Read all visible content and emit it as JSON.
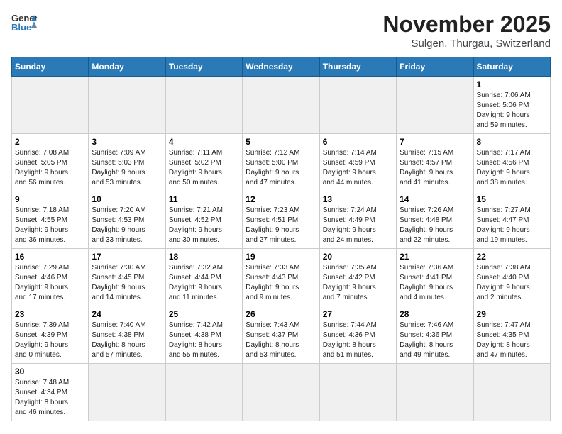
{
  "header": {
    "logo_text_general": "General",
    "logo_text_blue": "Blue",
    "month_title": "November 2025",
    "subtitle": "Sulgen, Thurgau, Switzerland"
  },
  "weekdays": [
    "Sunday",
    "Monday",
    "Tuesday",
    "Wednesday",
    "Thursday",
    "Friday",
    "Saturday"
  ],
  "weeks": [
    {
      "days": [
        {
          "num": "",
          "info": "",
          "empty": true
        },
        {
          "num": "",
          "info": "",
          "empty": true
        },
        {
          "num": "",
          "info": "",
          "empty": true
        },
        {
          "num": "",
          "info": "",
          "empty": true
        },
        {
          "num": "",
          "info": "",
          "empty": true
        },
        {
          "num": "",
          "info": "",
          "empty": true
        },
        {
          "num": "1",
          "info": "Sunrise: 7:06 AM\nSunset: 5:06 PM\nDaylight: 9 hours\nand 59 minutes."
        }
      ]
    },
    {
      "days": [
        {
          "num": "2",
          "info": "Sunrise: 7:08 AM\nSunset: 5:05 PM\nDaylight: 9 hours\nand 56 minutes."
        },
        {
          "num": "3",
          "info": "Sunrise: 7:09 AM\nSunset: 5:03 PM\nDaylight: 9 hours\nand 53 minutes."
        },
        {
          "num": "4",
          "info": "Sunrise: 7:11 AM\nSunset: 5:02 PM\nDaylight: 9 hours\nand 50 minutes."
        },
        {
          "num": "5",
          "info": "Sunrise: 7:12 AM\nSunset: 5:00 PM\nDaylight: 9 hours\nand 47 minutes."
        },
        {
          "num": "6",
          "info": "Sunrise: 7:14 AM\nSunset: 4:59 PM\nDaylight: 9 hours\nand 44 minutes."
        },
        {
          "num": "7",
          "info": "Sunrise: 7:15 AM\nSunset: 4:57 PM\nDaylight: 9 hours\nand 41 minutes."
        },
        {
          "num": "8",
          "info": "Sunrise: 7:17 AM\nSunset: 4:56 PM\nDaylight: 9 hours\nand 38 minutes."
        }
      ]
    },
    {
      "days": [
        {
          "num": "9",
          "info": "Sunrise: 7:18 AM\nSunset: 4:55 PM\nDaylight: 9 hours\nand 36 minutes."
        },
        {
          "num": "10",
          "info": "Sunrise: 7:20 AM\nSunset: 4:53 PM\nDaylight: 9 hours\nand 33 minutes."
        },
        {
          "num": "11",
          "info": "Sunrise: 7:21 AM\nSunset: 4:52 PM\nDaylight: 9 hours\nand 30 minutes."
        },
        {
          "num": "12",
          "info": "Sunrise: 7:23 AM\nSunset: 4:51 PM\nDaylight: 9 hours\nand 27 minutes."
        },
        {
          "num": "13",
          "info": "Sunrise: 7:24 AM\nSunset: 4:49 PM\nDaylight: 9 hours\nand 24 minutes."
        },
        {
          "num": "14",
          "info": "Sunrise: 7:26 AM\nSunset: 4:48 PM\nDaylight: 9 hours\nand 22 minutes."
        },
        {
          "num": "15",
          "info": "Sunrise: 7:27 AM\nSunset: 4:47 PM\nDaylight: 9 hours\nand 19 minutes."
        }
      ]
    },
    {
      "days": [
        {
          "num": "16",
          "info": "Sunrise: 7:29 AM\nSunset: 4:46 PM\nDaylight: 9 hours\nand 17 minutes."
        },
        {
          "num": "17",
          "info": "Sunrise: 7:30 AM\nSunset: 4:45 PM\nDaylight: 9 hours\nand 14 minutes."
        },
        {
          "num": "18",
          "info": "Sunrise: 7:32 AM\nSunset: 4:44 PM\nDaylight: 9 hours\nand 11 minutes."
        },
        {
          "num": "19",
          "info": "Sunrise: 7:33 AM\nSunset: 4:43 PM\nDaylight: 9 hours\nand 9 minutes."
        },
        {
          "num": "20",
          "info": "Sunrise: 7:35 AM\nSunset: 4:42 PM\nDaylight: 9 hours\nand 7 minutes."
        },
        {
          "num": "21",
          "info": "Sunrise: 7:36 AM\nSunset: 4:41 PM\nDaylight: 9 hours\nand 4 minutes."
        },
        {
          "num": "22",
          "info": "Sunrise: 7:38 AM\nSunset: 4:40 PM\nDaylight: 9 hours\nand 2 minutes."
        }
      ]
    },
    {
      "days": [
        {
          "num": "23",
          "info": "Sunrise: 7:39 AM\nSunset: 4:39 PM\nDaylight: 9 hours\nand 0 minutes."
        },
        {
          "num": "24",
          "info": "Sunrise: 7:40 AM\nSunset: 4:38 PM\nDaylight: 8 hours\nand 57 minutes."
        },
        {
          "num": "25",
          "info": "Sunrise: 7:42 AM\nSunset: 4:38 PM\nDaylight: 8 hours\nand 55 minutes."
        },
        {
          "num": "26",
          "info": "Sunrise: 7:43 AM\nSunset: 4:37 PM\nDaylight: 8 hours\nand 53 minutes."
        },
        {
          "num": "27",
          "info": "Sunrise: 7:44 AM\nSunset: 4:36 PM\nDaylight: 8 hours\nand 51 minutes."
        },
        {
          "num": "28",
          "info": "Sunrise: 7:46 AM\nSunset: 4:36 PM\nDaylight: 8 hours\nand 49 minutes."
        },
        {
          "num": "29",
          "info": "Sunrise: 7:47 AM\nSunset: 4:35 PM\nDaylight: 8 hours\nand 47 minutes."
        }
      ]
    },
    {
      "days": [
        {
          "num": "30",
          "info": "Sunrise: 7:48 AM\nSunset: 4:34 PM\nDaylight: 8 hours\nand 46 minutes."
        },
        {
          "num": "",
          "info": "",
          "empty": true
        },
        {
          "num": "",
          "info": "",
          "empty": true
        },
        {
          "num": "",
          "info": "",
          "empty": true
        },
        {
          "num": "",
          "info": "",
          "empty": true
        },
        {
          "num": "",
          "info": "",
          "empty": true
        },
        {
          "num": "",
          "info": "",
          "empty": true
        }
      ]
    }
  ]
}
